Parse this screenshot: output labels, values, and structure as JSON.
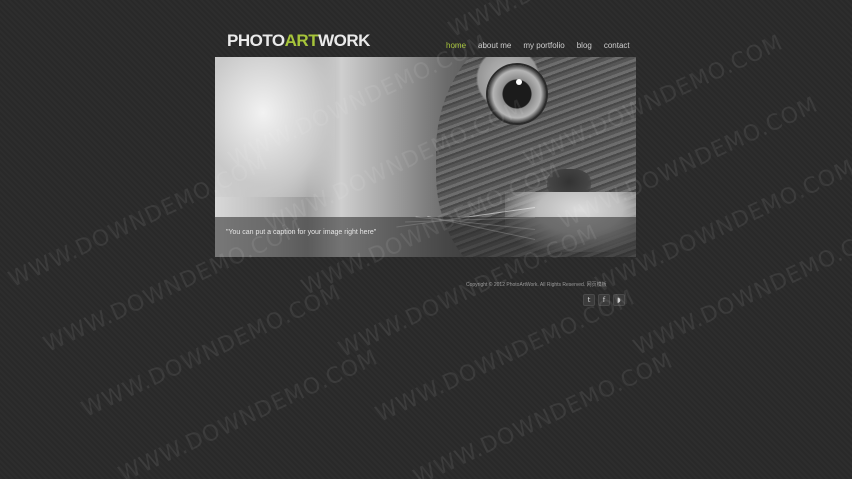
{
  "brand": {
    "part1": "PHOTO",
    "part2": "ART",
    "part3": "WORK"
  },
  "nav": [
    {
      "label": "home",
      "active": true
    },
    {
      "label": "about me",
      "active": false
    },
    {
      "label": "my portfolio",
      "active": false
    },
    {
      "label": "blog",
      "active": false
    },
    {
      "label": "contact",
      "active": false
    }
  ],
  "hero": {
    "caption": "\"You can put a caption for your image right here\""
  },
  "footer": {
    "copyright": "Copyright © 2012 PhotoArtWork. All Rights Reserved. 网页模板"
  },
  "social": [
    {
      "icon": "twitter-icon",
      "glyph": "t"
    },
    {
      "icon": "facebook-icon",
      "glyph": "f"
    },
    {
      "icon": "rss-icon",
      "glyph": "◗"
    }
  ],
  "watermark": "WWW.DOWNDEMO.COM",
  "colors": {
    "accent": "#a6c43a",
    "background": "#2a2a2a"
  }
}
